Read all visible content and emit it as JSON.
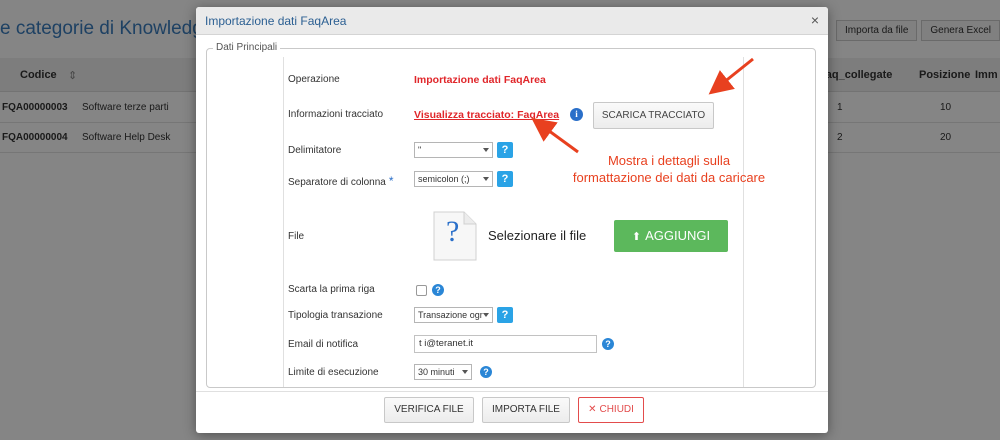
{
  "background": {
    "page_title": "e categorie di Knowledge",
    "toolbar": {
      "import_label": "Importa da file",
      "export_label": "Genera Excel"
    },
    "table": {
      "headers": {
        "codice": "Codice",
        "sort_icon": "⇕",
        "faq_collegate": "_faq_collegate",
        "posizione": "Posizione",
        "imm": "Imm"
      },
      "rows": [
        {
          "code": "FQA00000003",
          "name": "Software terze parti",
          "faq": "1",
          "pos": "10"
        },
        {
          "code": "FQA00000004",
          "name": "Software Help Desk",
          "faq": "2",
          "pos": "20"
        }
      ]
    }
  },
  "modal": {
    "title": "Importazione dati FaqArea",
    "close_icon": "×",
    "section_legend": "Dati Principali",
    "fields": {
      "operazione_label": "Operazione",
      "operazione_value": "Importazione dati FaqArea",
      "tracciato_label": "Informazioni tracciato",
      "tracciato_link": "Visualizza tracciato: FaqArea",
      "tracciato_info_icon": "i",
      "scarica_button": "SCARICA TRACCIATO",
      "delimitatore_label": "Delimitatore",
      "delimitatore_value": "\"",
      "separatore_label": "Separatore di colonna",
      "separatore_required": "*",
      "separatore_value": "semicolon (;)",
      "file_label": "File",
      "file_icon_glyph": "?",
      "file_prompt": "Selezionare il file",
      "aggiungi_button": "AGGIUNGI",
      "aggiungi_icon": "⬆",
      "scarta_label": "Scarta la prima riga",
      "tipologia_label": "Tipologia transazione",
      "tipologia_value": "Transazione ogr",
      "email_label": "Email di notifica",
      "email_value": "t          i@teranet.it",
      "limite_label": "Limite di esecuzione",
      "limite_value": "30 minuti",
      "help_glyph": "?"
    },
    "annotation": {
      "line1": "Mostra i dettagli sulla",
      "line2": "formattazione dei dati da caricare",
      "color": "#e8401f"
    },
    "footer": {
      "verifica_button": "VERIFICA FILE",
      "importa_button": "IMPORTA FILE",
      "chiudi_button": "CHIUDI",
      "chiudi_icon": "✕"
    }
  }
}
